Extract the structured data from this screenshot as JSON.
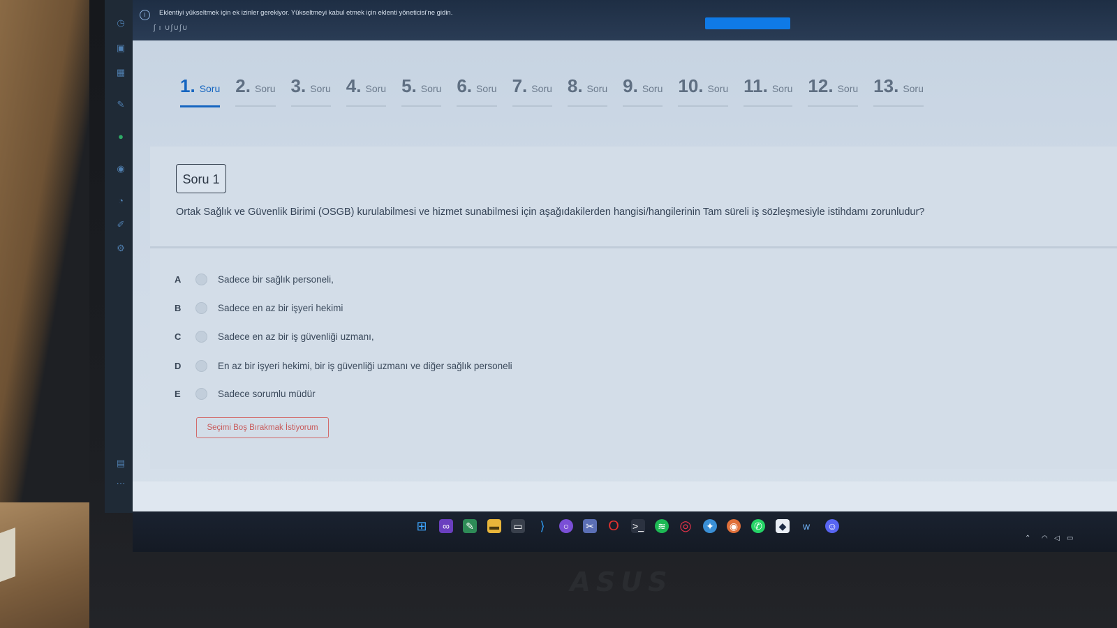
{
  "notification": {
    "text": "Eklentiyi yükseltmek için ek izinler gerekiyor. Yükseltmeyi kabul etmek için eklenti yöneticisi'ne gidin.",
    "sub_text": "ʃ ı ∪ʃ∪ʃ∪"
  },
  "tabs": [
    {
      "num": "1.",
      "label": "Soru",
      "active": true
    },
    {
      "num": "2.",
      "label": "Soru"
    },
    {
      "num": "3.",
      "label": "Soru"
    },
    {
      "num": "4.",
      "label": "Soru"
    },
    {
      "num": "5.",
      "label": "Soru"
    },
    {
      "num": "6.",
      "label": "Soru"
    },
    {
      "num": "7.",
      "label": "Soru"
    },
    {
      "num": "8.",
      "label": "Soru"
    },
    {
      "num": "9.",
      "label": "Soru"
    },
    {
      "num": "10.",
      "label": "Soru"
    },
    {
      "num": "11.",
      "label": "Soru"
    },
    {
      "num": "12.",
      "label": "Soru"
    },
    {
      "num": "13.",
      "label": "Soru"
    }
  ],
  "question": {
    "badge": "Soru 1",
    "text": "Ortak Sağlık ve Güvenlik Birimi (OSGB) kurulabilmesi ve hizmet sunabilmesi için aşağıdakilerden hangisi/hangilerinin Tam süreli iş sözleşmesiyle istihdamı zorunludur?"
  },
  "options": [
    {
      "letter": "A",
      "text": "Sadece bir sağlık personeli,"
    },
    {
      "letter": "B",
      "text": "Sadece en az bir işyeri hekimi"
    },
    {
      "letter": "C",
      "text": "Sadece en az bir iş güvenliği uzmanı,"
    },
    {
      "letter": "D",
      "text": "En az bir işyeri hekimi, bir iş güvenliği uzmanı ve diğer sağlık personeli"
    },
    {
      "letter": "E",
      "text": "Sadece sorumlu müdür"
    }
  ],
  "blank_button": "Seçimi Boş Bırakmak İstiyorum",
  "brand": "ASUS",
  "taskbar_icons": [
    "windows-start-icon",
    "visual-studio-icon",
    "notepad-icon",
    "file-explorer-icon",
    "terminal-window-icon",
    "vscode-icon",
    "github-desktop-icon",
    "snipping-tool-icon",
    "opera-icon",
    "powershell-icon",
    "spotify-icon",
    "opera-gx-icon",
    "browser-icon",
    "chrome-icon",
    "whatsapp-icon",
    "app-icon",
    "word-icon",
    "discord-icon"
  ],
  "colors": {
    "accent": "#1565c0",
    "danger": "#c85a5a",
    "taskbar": "#141a24"
  }
}
